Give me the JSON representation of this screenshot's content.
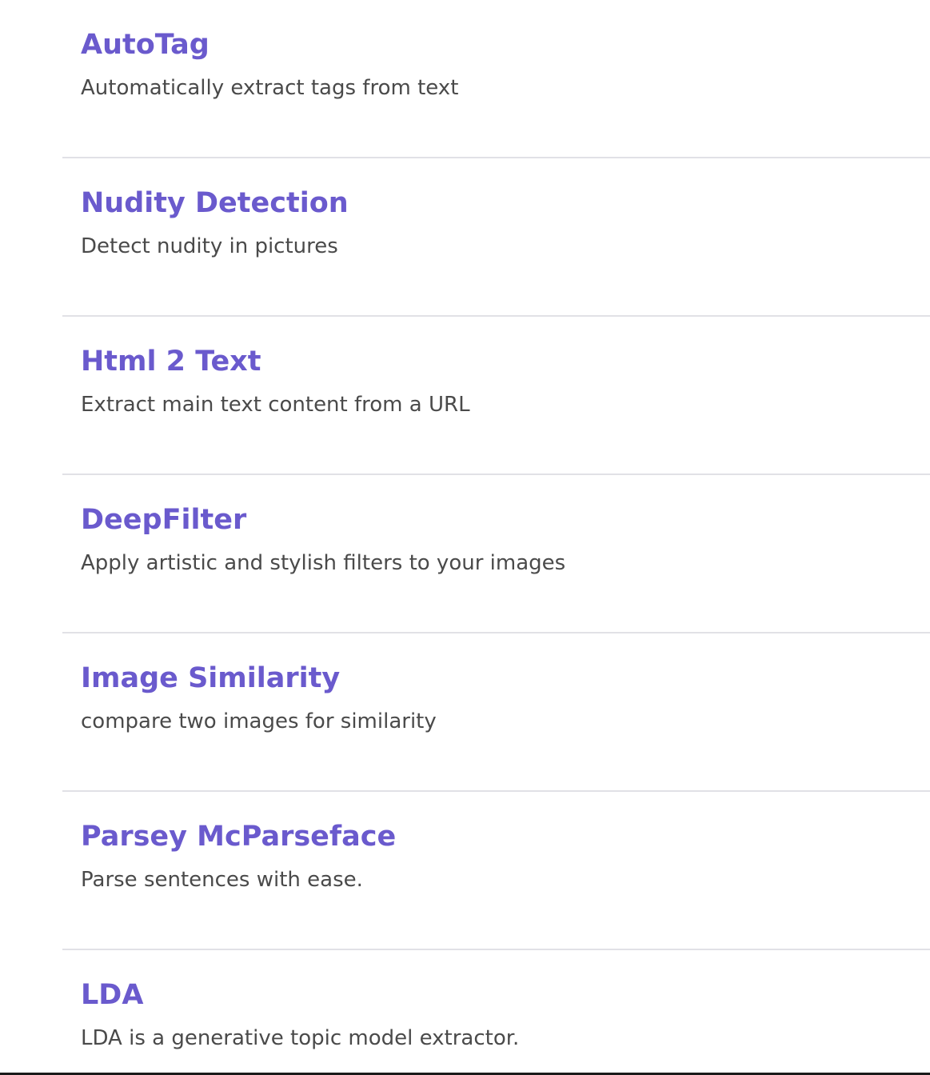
{
  "services": [
    {
      "name": "AutoTag",
      "description": "Automatically extract tags from text"
    },
    {
      "name": "Nudity Detection",
      "description": "Detect nudity in pictures"
    },
    {
      "name": "Html 2 Text",
      "description": "Extract main text content from a URL"
    },
    {
      "name": "DeepFilter",
      "description": "Apply artistic and stylish filters to your images"
    },
    {
      "name": "Image Similarity",
      "description": "compare two images for similarity"
    },
    {
      "name": "Parsey McParseface",
      "description": "Parse sentences with ease."
    },
    {
      "name": "LDA",
      "description": "LDA is a generative topic model extractor."
    }
  ],
  "colors": {
    "title": "#6a5acd",
    "description": "#4a4a4a",
    "divider": "#e1e1e6",
    "background": "#ffffff"
  }
}
